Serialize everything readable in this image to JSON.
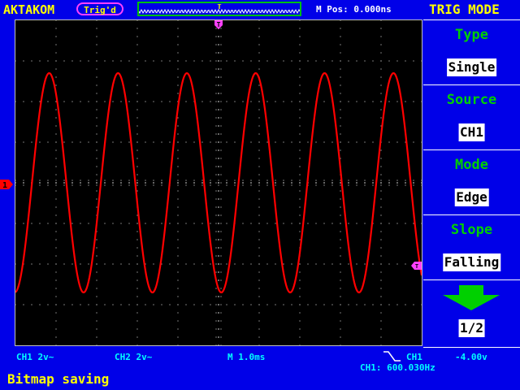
{
  "header": {
    "brand": "AKTAKOM",
    "trig_status": "Trig'd",
    "trigger_pos_marker": "T",
    "mpos": "M Pos: 0.000ns",
    "menu_title": "TRIG MODE"
  },
  "screen": {
    "trigger_marker_top": "T",
    "channel_marker": "1",
    "level_marker": "T"
  },
  "menu": [
    {
      "label": "Type",
      "value": "Single"
    },
    {
      "label": "Source",
      "value": "CH1"
    },
    {
      "label": "Mode",
      "value": "Edge"
    },
    {
      "label": "Slope",
      "value": "Falling"
    }
  ],
  "page_indicator": "1/2",
  "status": {
    "ch1_scale": "CH1  2v~",
    "ch2_scale": "CH2  2v~",
    "timebase": "M  1.0ms",
    "trig_source": "CH1",
    "trig_level": "-4.00v",
    "frequency": "CH1: 600.030Hz"
  },
  "message": "Bitmap saving",
  "colors": {
    "background": "#0000e8",
    "trace": "#ff0000",
    "accent": "#00d000",
    "trigger_marker": "#ff40ff"
  },
  "waveform": {
    "type": "sine",
    "cycles_visible": 5.9,
    "amplitude_divs": 2.7,
    "offset_divs": 0.0
  }
}
